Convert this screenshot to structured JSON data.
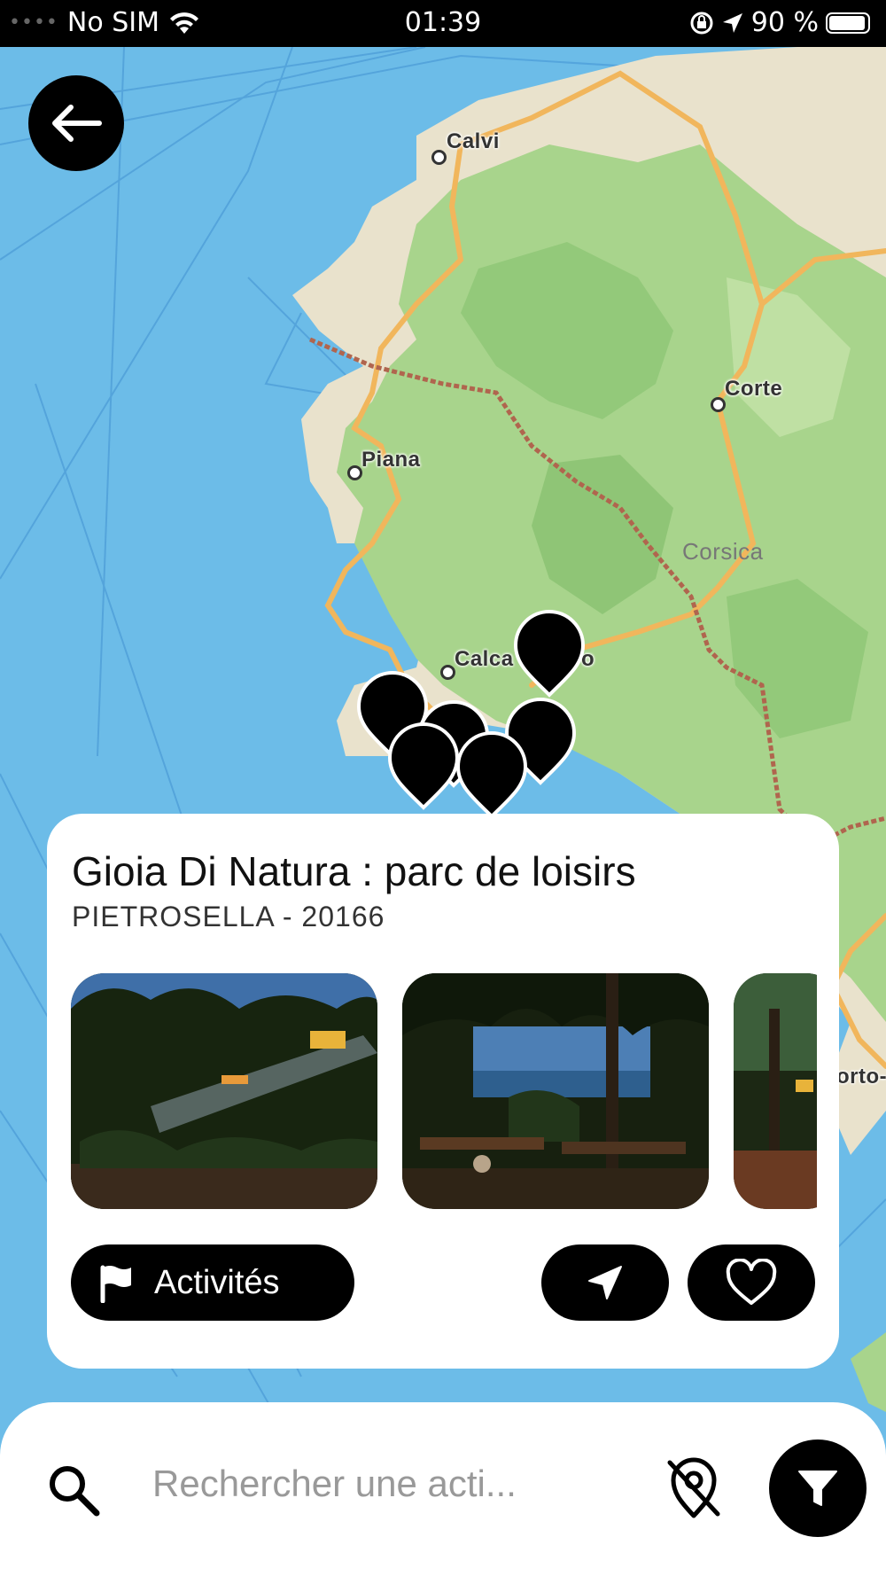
{
  "status_bar": {
    "carrier": "No SIM",
    "time": "01:39",
    "battery": "90 %"
  },
  "map": {
    "places": {
      "calvi": "Calvi",
      "corte": "Corte",
      "piana": "Piana",
      "calcatoggio_partial": "Calca",
      "calcatoggio_tail": "o",
      "porto_partial": "orto-"
    },
    "region": "Corsica",
    "marker_count": 6,
    "colors": {
      "water": "#6cbce8",
      "land": "#e9e2cc",
      "forest": "#a8d48c",
      "road": "#f1b65c",
      "trail": "#b0654e"
    }
  },
  "card": {
    "title": "Gioia Di Natura : parc de loisirs",
    "subtitle": "PIETROSELLA - 20166",
    "photos_count": 3,
    "activities_label": "Activités"
  },
  "bottom_bar": {
    "search_placeholder": "Rechercher une acti..."
  }
}
